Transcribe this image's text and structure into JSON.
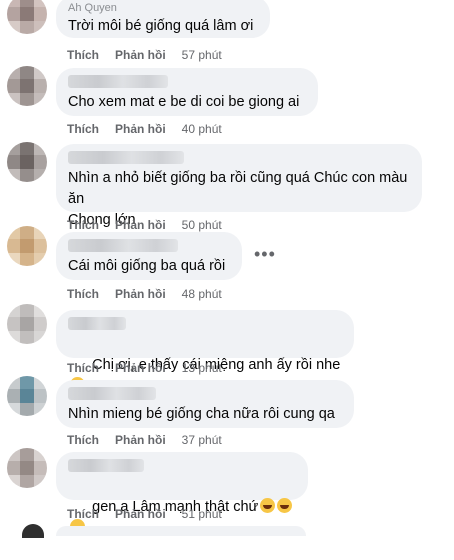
{
  "comments": [
    {
      "name": "Ah Quyen",
      "text": "Trời môi bé giống quá lâm ơi",
      "like": "Thích",
      "reply": "Phản hồi",
      "time": "57 phút"
    },
    {
      "name": "",
      "text": "Cho xem mat e be di coi be giong ai",
      "like": "Thích",
      "reply": "Phản hồi",
      "time": "40 phút"
    },
    {
      "name": "",
      "text": "Nhìn a nhỏ biết giống ba rồi cũng quá Chúc con màu ăn\nChong lớn",
      "like": "Thích",
      "reply": "Phản hồi",
      "time": "50 phút"
    },
    {
      "name": "",
      "text": "Cái môi giống ba quá rồi",
      "like": "Thích",
      "reply": "Phản hồi",
      "time": "48 phút"
    },
    {
      "name": "",
      "text": "Chị ơi, e thấy cái miệng anh ấy rồi nhe",
      "like": "Thích",
      "reply": "Phản hồi",
      "time": "13 phút"
    },
    {
      "name": "",
      "text": "Nhìn mieng bé giống cha nữa rôi cung qa",
      "like": "Thích",
      "reply": "Phản hồi",
      "time": "37 phút"
    },
    {
      "name": "",
      "text": "gen a Lâm mạnh thật chứ",
      "like": "Thích",
      "reply": "Phản hồi",
      "time": "51 phút"
    }
  ],
  "more_options": "•••",
  "icons": {
    "heart_eyes": "heart-eyes-emoji",
    "laughing": "rofl-emoji",
    "more": "more-options-icon"
  },
  "colors": {
    "bubble": "#f0f2f5",
    "meta_text": "#65676b",
    "text": "#050505"
  }
}
